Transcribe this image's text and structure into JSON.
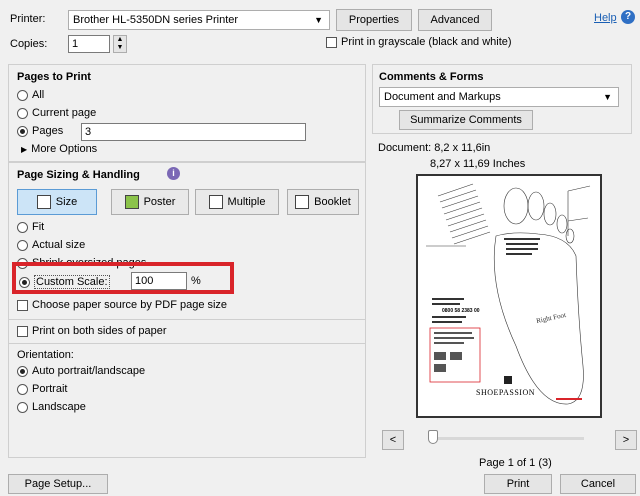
{
  "printer": {
    "label": "Printer:",
    "selected": "Brother HL-5350DN series Printer",
    "properties_label": "Properties",
    "advanced_label": "Advanced",
    "help_label": "Help"
  },
  "copies": {
    "label": "Copies:",
    "value": "1",
    "grayscale_label": "Print in grayscale (black and white)"
  },
  "pages_to_print": {
    "title": "Pages to Print",
    "all_label": "All",
    "current_label": "Current page",
    "pages_label": "Pages",
    "pages_value": "3",
    "more_options_label": "More Options"
  },
  "sizing": {
    "title": "Page Sizing & Handling",
    "tabs": [
      "Size",
      "Poster",
      "Multiple",
      "Booklet"
    ],
    "fit_label": "Fit",
    "actual_label": "Actual size",
    "shrink_label": "Shrink oversized pages",
    "custom_label": "Custom Scale:",
    "custom_value": "100",
    "percent": "%",
    "paper_source_label": "Choose paper source by PDF page size",
    "both_sides_label": "Print on both sides of paper"
  },
  "orientation": {
    "title": "Orientation:",
    "auto_label": "Auto portrait/landscape",
    "portrait_label": "Portrait",
    "landscape_label": "Landscape"
  },
  "comments": {
    "title": "Comments & Forms",
    "selected": "Document and Markups",
    "summarize_label": "Summarize Comments"
  },
  "preview": {
    "document_size": "Document: 8,2 x 11,6in",
    "page_size": "8,27 x 11,69 Inches",
    "page_counter": "Page 1 of 1 (3)",
    "prev": "<",
    "next": ">"
  },
  "thumb": {
    "brand": "SHOEPASSION",
    "right_foot": "Right Foot",
    "phone_line": "0800 58 2383 00"
  },
  "footer": {
    "page_setup_label": "Page Setup...",
    "print_label": "Print",
    "cancel_label": "Cancel"
  },
  "colors": {
    "highlight_red": "#d9242a",
    "link_blue": "#1a5fb4",
    "accent_purple": "#7b68b5",
    "selected_blue": "#cce4f7"
  }
}
